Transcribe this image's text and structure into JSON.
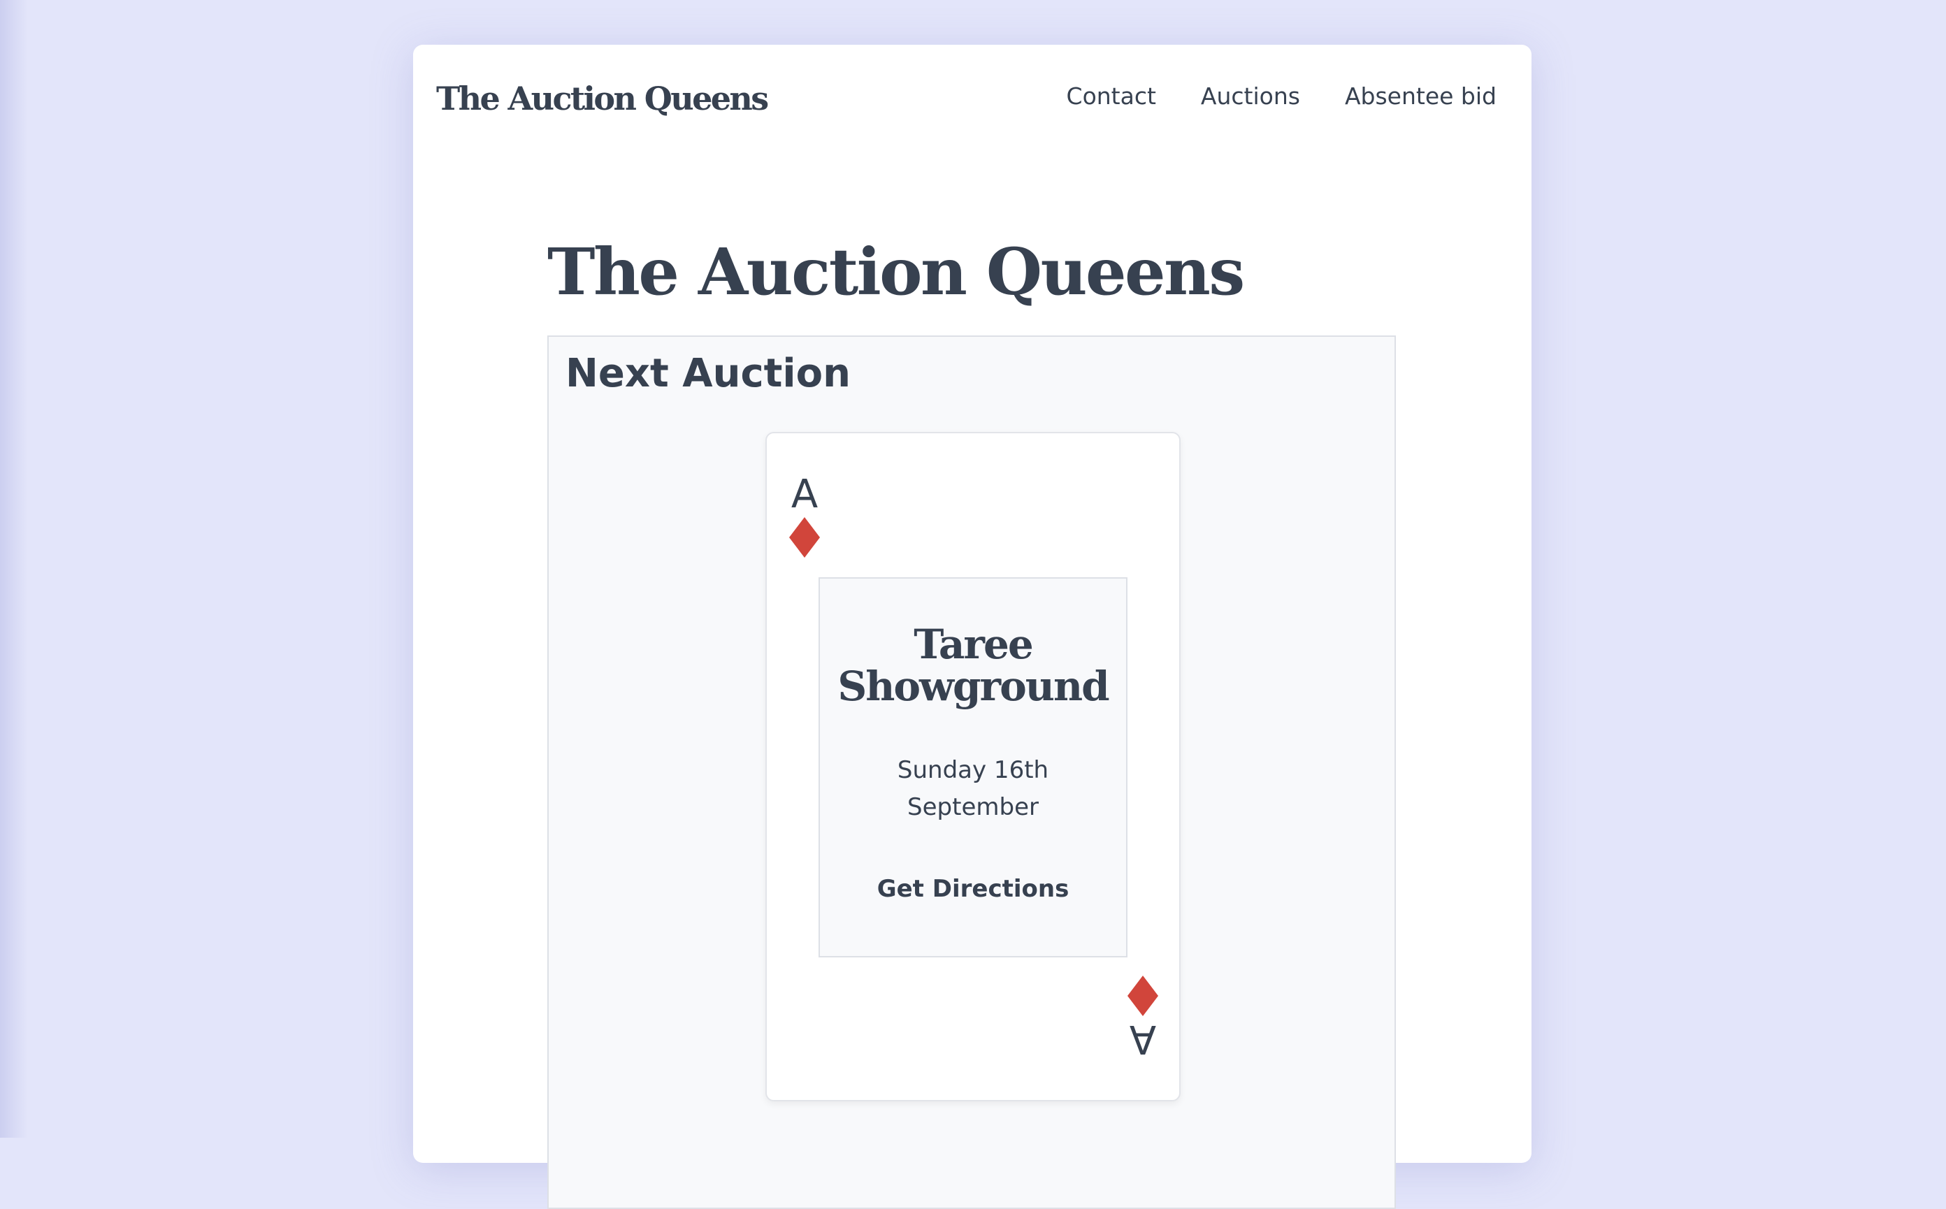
{
  "header": {
    "logo": "The Auction Queens",
    "nav": [
      "Contact",
      "Auctions",
      "Absentee bid"
    ]
  },
  "main": {
    "title": "The Auction Queens",
    "next_auction": {
      "heading": "Next Auction",
      "card": {
        "rank": "A",
        "suit_icon": "diamond-icon",
        "suit_color": "#d1453b",
        "venue": "Taree Showground",
        "date": "Sunday 16th September",
        "directions_label": "Get Directions"
      }
    }
  },
  "colors": {
    "background": "#e3e5fa",
    "text": "#374150",
    "panel": "#f8f9fb"
  }
}
